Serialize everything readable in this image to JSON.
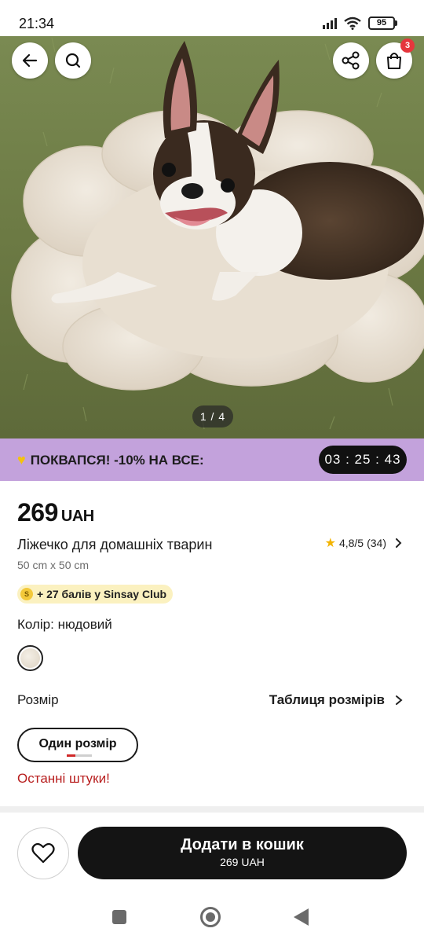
{
  "status_bar": {
    "time": "21:34",
    "battery": "95"
  },
  "gallery": {
    "pager": "1 / 4",
    "cart_count": "3"
  },
  "promo": {
    "text": "ПОКВАПСЯ! -10% НА ВСЕ:",
    "timer": "03 : 25 : 43",
    "background": "#c3a2dc"
  },
  "product": {
    "price": "269",
    "currency": "UAH",
    "title": "Ліжечко для домашніх тварин",
    "dimensions": "50 cm x 50 cm",
    "rating": "4,8/5",
    "reviews": "(34)",
    "loyalty": "+ 27 балів у Sinsay Club",
    "color_label": "Колір: нюдовий",
    "size_label": "Розмір",
    "size_chart": "Таблиця розмірів",
    "size_option": "Один розмір",
    "stock_note": "Останні штуки!"
  },
  "actions": {
    "add_to_cart": "Додати в кошик",
    "add_price": "269 UAH"
  },
  "colors": {
    "accent_dark": "#141414",
    "promo": "#c3a2dc",
    "warning": "#b81e1e",
    "star": "#f3b400"
  }
}
